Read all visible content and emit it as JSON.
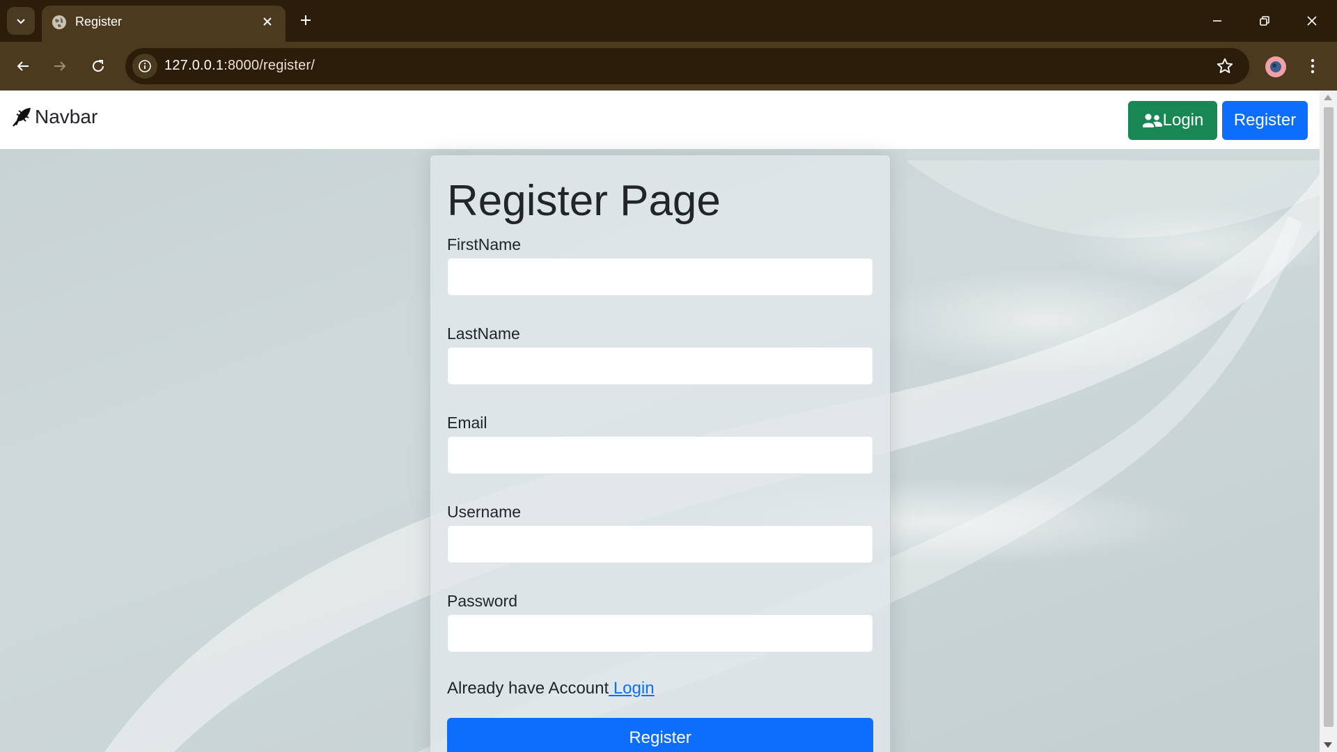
{
  "browser": {
    "tab_title": "Register",
    "url_host": "127.0.0.1",
    "url_rest": ":8000/register/",
    "icons": [
      "tab-list-icon",
      "globe-icon",
      "close-icon",
      "plus-icon",
      "minimize-icon",
      "restore-icon",
      "window-close-icon",
      "back-icon",
      "forward-icon",
      "reload-icon",
      "info-icon",
      "star-icon",
      "profile-avatar",
      "more-menu-icon"
    ]
  },
  "navbar": {
    "brand": "Navbar",
    "login_label": "Login",
    "register_label": "Register"
  },
  "form": {
    "title": "Register Page",
    "fields": [
      {
        "label": "FirstName",
        "value": ""
      },
      {
        "label": "LastName",
        "value": ""
      },
      {
        "label": "Email",
        "value": ""
      },
      {
        "label": "Username",
        "value": ""
      },
      {
        "label": "Password",
        "value": ""
      }
    ],
    "already_text": "Already have Account",
    "login_link": " Login",
    "submit_label": "Register"
  },
  "colors": {
    "login_button": "#198754",
    "primary_button": "#0d6efd",
    "chrome_frame": "#2b1d09",
    "chrome_toolbar": "#4c3a1f"
  }
}
